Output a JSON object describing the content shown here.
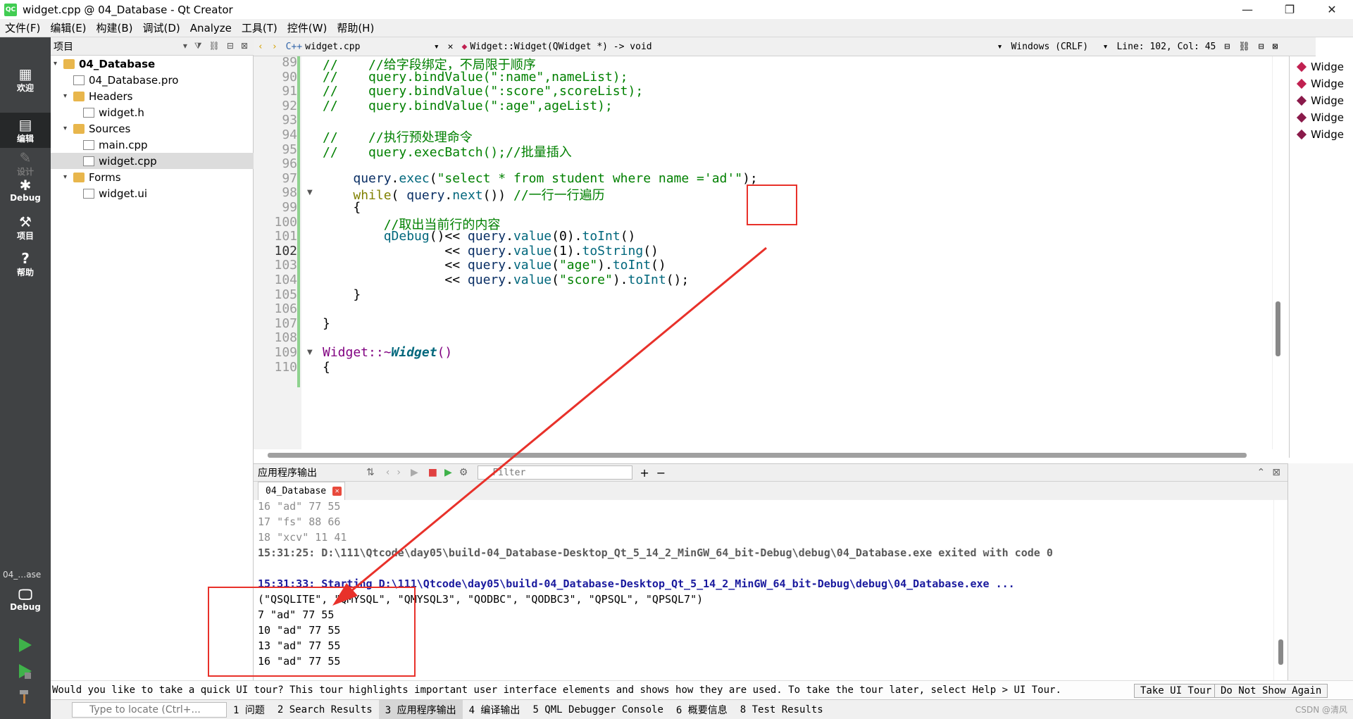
{
  "window": {
    "title": "widget.cpp @ 04_Database - Qt Creator",
    "app_icon": "QC",
    "minimize": "—",
    "restore": "❐",
    "close": "✕"
  },
  "menu": [
    "文件(F)",
    "编辑(E)",
    "构建(B)",
    "调试(D)",
    "Analyze",
    "工具(T)",
    "控件(W)",
    "帮助(H)"
  ],
  "modes": [
    {
      "icon": "grid-icon",
      "glyph": "▦",
      "label": "欢迎"
    },
    {
      "icon": "edit-icon",
      "glyph": "▤",
      "label": "编辑"
    },
    {
      "icon": "design-icon",
      "glyph": "✎",
      "label": "设计"
    },
    {
      "icon": "bug-icon",
      "glyph": "✱",
      "label": "Debug"
    },
    {
      "icon": "wrench-icon",
      "glyph": "⚒",
      "label": "项目"
    },
    {
      "icon": "help-icon",
      "glyph": "?",
      "label": "帮助"
    }
  ],
  "target": {
    "project": "04_…ase",
    "label": "Debug"
  },
  "project_panel": {
    "title": "项目",
    "nodes": [
      {
        "label": "04_Database",
        "kind": "project"
      },
      {
        "label": "04_Database.pro",
        "kind": "file"
      },
      {
        "label": "Headers",
        "kind": "folder"
      },
      {
        "label": "widget.h",
        "kind": "file"
      },
      {
        "label": "Sources",
        "kind": "folder"
      },
      {
        "label": "main.cpp",
        "kind": "file"
      },
      {
        "label": "widget.cpp",
        "kind": "file"
      },
      {
        "label": "Forms",
        "kind": "folder"
      },
      {
        "label": "widget.ui",
        "kind": "file"
      }
    ]
  },
  "editor_header": {
    "file": "widget.cpp",
    "symbol": "Widget::Widget(QWidget *) -> void",
    "line_ending": "Windows (CRLF)",
    "position": "Line: 102, Col: 45"
  },
  "code_lines": [
    {
      "n": "89",
      "text": "//    //给字段绑定，不局限于顺序"
    },
    {
      "n": "90",
      "text": "//    query.bindValue(\":name\",nameList);"
    },
    {
      "n": "91",
      "text": "//    query.bindValue(\":score\",scoreList);"
    },
    {
      "n": "92",
      "text": "//    query.bindValue(\":age\",ageList);"
    },
    {
      "n": "93",
      "text": ""
    },
    {
      "n": "94",
      "text": "//    //执行预处理命令"
    },
    {
      "n": "95",
      "text": "//    query.execBatch();//批量插入"
    },
    {
      "n": "96",
      "text": ""
    },
    {
      "n": "97",
      "text": "    query.exec(\"select * from student where name ='ad'\");"
    },
    {
      "n": "98",
      "text": "    while( query.next()) //一行一行遍历"
    },
    {
      "n": "99",
      "text": "    {"
    },
    {
      "n": "100",
      "text": "        //取出当前行的内容"
    },
    {
      "n": "101",
      "text": "        qDebug()<< query.value(0).toInt()"
    },
    {
      "n": "102",
      "text": "                << query.value(1).toString()"
    },
    {
      "n": "103",
      "text": "                << query.value(\"age\").toInt()"
    },
    {
      "n": "104",
      "text": "                << query.value(\"score\").toInt();"
    },
    {
      "n": "105",
      "text": "    }"
    },
    {
      "n": "106",
      "text": ""
    },
    {
      "n": "107",
      "text": "}"
    },
    {
      "n": "108",
      "text": ""
    },
    {
      "n": "109",
      "text": "Widget::~Widget()"
    },
    {
      "n": "110",
      "text": "{"
    }
  ],
  "outline": [
    "Widge",
    "Widge",
    "Widge",
    "Widge",
    "Widge"
  ],
  "output_panel": {
    "title": "应用程序输出",
    "filter_placeholder": "Filter",
    "tab": "04_Database",
    "lines": [
      {
        "style": "dim",
        "text": "16 \"ad\" 77 55"
      },
      {
        "style": "dim",
        "text": "17 \"fs\" 88 66"
      },
      {
        "style": "dim",
        "text": "18 \"xcv\" 11 41"
      },
      {
        "style": "exit",
        "text": "15:31:25: D:\\111\\Qtcode\\day05\\build-04_Database-Desktop_Qt_5_14_2_MinGW_64_bit-Debug\\debug\\04_Database.exe exited with code 0"
      },
      {
        "style": "norm",
        "text": ""
      },
      {
        "style": "start",
        "text": "15:31:33: Starting D:\\111\\Qtcode\\day05\\build-04_Database-Desktop_Qt_5_14_2_MinGW_64_bit-Debug\\debug\\04_Database.exe ..."
      },
      {
        "style": "norm",
        "text": "(\"QSQLITE\", \"QMYSQL\", \"QMYSQL3\", \"QODBC\", \"QODBC3\", \"QPSQL\", \"QPSQL7\")"
      },
      {
        "style": "norm",
        "text": "7 \"ad\" 77 55"
      },
      {
        "style": "norm",
        "text": "10 \"ad\" 77 55"
      },
      {
        "style": "norm",
        "text": "13 \"ad\" 77 55"
      },
      {
        "style": "norm",
        "text": "16 \"ad\" 77 55"
      }
    ]
  },
  "tour": {
    "message": "Would you like to take a quick UI tour? This tour highlights important user interface elements and shows how they are used. To take the tour later, select Help > UI Tour.",
    "take": "Take UI Tour",
    "dismiss": "Do Not Show Again"
  },
  "statusbar": {
    "locate_placeholder": "Type to locate (Ctrl+...",
    "panes": [
      "1 问题",
      "2 Search Results",
      "3 应用程序输出",
      "4 编译输出",
      "5 QML Debugger Console",
      "6 概要信息",
      "8 Test Results"
    ],
    "watermark": "CSDN @清风"
  },
  "colors": {
    "modebar": "#404244",
    "annotation": "#e8312a",
    "comment": "#008000",
    "function": "#00677c",
    "keyword": "#808000"
  }
}
